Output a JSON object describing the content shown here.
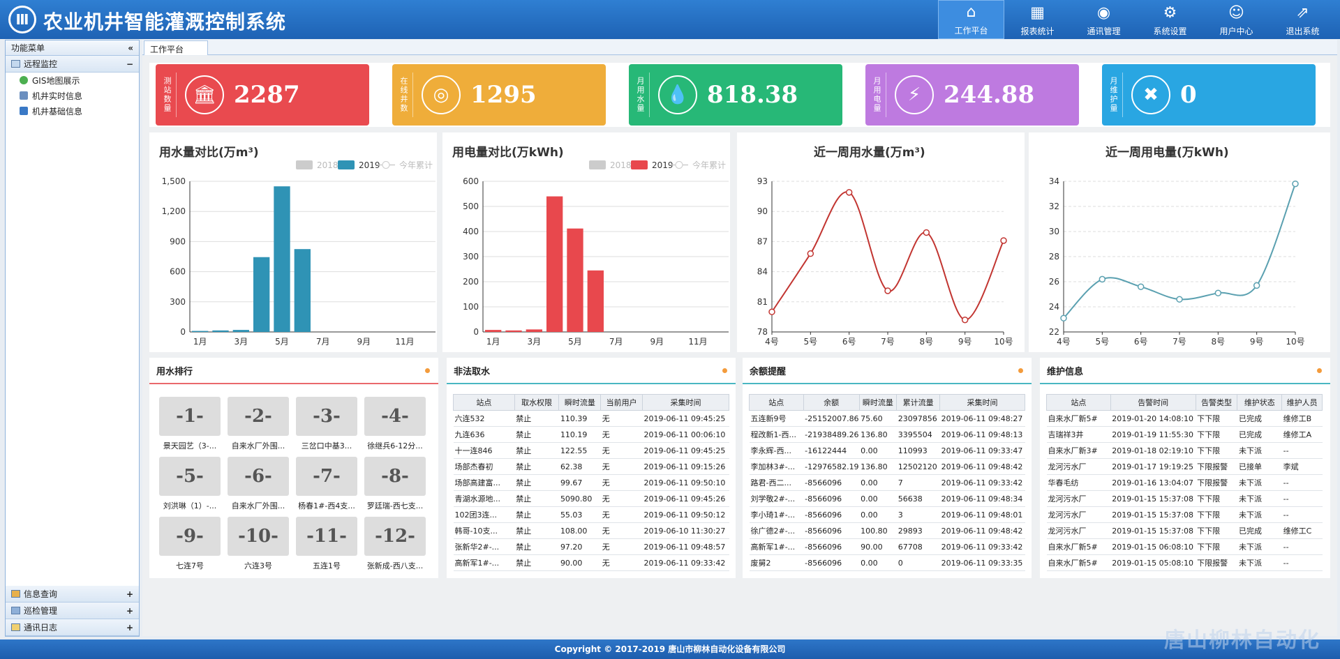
{
  "header": {
    "logo_glyph": "Ⅲ",
    "title": "农业机井智能灌溉控制系统",
    "nav": [
      {
        "label": "工作平台",
        "icon": "home-icon"
      },
      {
        "label": "报表统计",
        "icon": "report-icon"
      },
      {
        "label": "通讯管理",
        "icon": "antenna-icon"
      },
      {
        "label": "系统设置",
        "icon": "gear-icon"
      },
      {
        "label": "用户中心",
        "icon": "user-card-icon"
      },
      {
        "label": "退出系统",
        "icon": "exit-icon"
      }
    ]
  },
  "sidebar": {
    "title": "功能菜单",
    "collapse": "«",
    "groups_top": [
      {
        "label": "远程监控",
        "state": "−"
      }
    ],
    "items": [
      "GIS地图展示",
      "机井实时信息",
      "机井基础信息"
    ],
    "groups_bottom": [
      {
        "label": "信息查询",
        "state": "+"
      },
      {
        "label": "巡检管理",
        "state": "+"
      },
      {
        "label": "通讯日志",
        "state": "+"
      }
    ]
  },
  "tab": "工作平台",
  "kpis": [
    {
      "label": "测站数量",
      "value": "2287",
      "color": "#e94a4f",
      "icon": "temple-icon",
      "glyph": "🏛"
    },
    {
      "label": "在线井数",
      "value": "1295",
      "color": "#efad3a",
      "icon": "well-icon",
      "glyph": "◎"
    },
    {
      "label": "月用水量",
      "value": "818.38",
      "color": "#27b877",
      "icon": "water-drop-icon",
      "glyph": "💧"
    },
    {
      "label": "月用电量",
      "value": "244.88",
      "color": "#be7ae0",
      "icon": "lightning-icon",
      "glyph": "⚡"
    },
    {
      "label": "月维护量",
      "value": "0",
      "color": "#29a6e2",
      "icon": "tools-icon",
      "glyph": "✖"
    }
  ],
  "chart_data": [
    {
      "type": "bar",
      "title": "用水量对比(万m³)",
      "legend": [
        "2018",
        "2019",
        "今年累计"
      ],
      "categories": [
        "1月",
        "2月",
        "3月",
        "4月",
        "5月",
        "6月",
        "7月",
        "8月",
        "9月",
        "10月",
        "11月",
        "12月"
      ],
      "xticks": [
        "1月",
        "3月",
        "5月",
        "7月",
        "9月",
        "11月"
      ],
      "series": [
        {
          "name": "2019",
          "values": [
            10,
            15,
            20,
            745,
            1450,
            825,
            0,
            0,
            0,
            0,
            0,
            0
          ],
          "color": "#2f93b5"
        }
      ],
      "ylim": [
        0,
        1500
      ],
      "yticks": [
        "0",
        "300",
        "600",
        "900",
        "1,200",
        "1,500"
      ],
      "ytick_values": [
        0,
        300,
        600,
        900,
        1200,
        1500
      ],
      "grid": true,
      "legend_position": "top-right"
    },
    {
      "type": "bar",
      "title": "用电量对比(万kWh)",
      "legend": [
        "2018",
        "2019",
        "今年累计"
      ],
      "categories": [
        "1月",
        "2月",
        "3月",
        "4月",
        "5月",
        "6月",
        "7月",
        "8月",
        "9月",
        "10月",
        "11月",
        "12月"
      ],
      "xticks": [
        "1月",
        "3月",
        "5月",
        "7月",
        "9月",
        "11月"
      ],
      "series": [
        {
          "name": "2019",
          "values": [
            8,
            6,
            10,
            540,
            412,
            245,
            0,
            0,
            0,
            0,
            0,
            0
          ],
          "color": "#e8484d"
        }
      ],
      "ylim": [
        0,
        600
      ],
      "yticks": [
        "0",
        "100",
        "200",
        "300",
        "400",
        "500",
        "600"
      ],
      "ytick_values": [
        0,
        100,
        200,
        300,
        400,
        500,
        600
      ],
      "grid": true,
      "legend_position": "top-right"
    },
    {
      "type": "line",
      "title": "近一周用水量(万m³)",
      "x": [
        "4号",
        "5号",
        "6号",
        "7号",
        "8号",
        "9号",
        "10号"
      ],
      "values": [
        80,
        85.8,
        91.9,
        82.1,
        87.9,
        79.2,
        87.1
      ],
      "color": "#c23531",
      "ylim": [
        78,
        93
      ],
      "yticks": [
        "78",
        "81",
        "84",
        "87",
        "90",
        "93"
      ],
      "ytick_values": [
        78,
        81,
        84,
        87,
        90,
        93
      ],
      "grid": true
    },
    {
      "type": "line",
      "title": "近一周用电量(万kWh)",
      "x": [
        "4号",
        "5号",
        "6号",
        "7号",
        "8号",
        "9号",
        "10号"
      ],
      "values": [
        23.1,
        26.2,
        25.6,
        24.6,
        25.1,
        25.7,
        33.8
      ],
      "color": "#5aa0b0",
      "ylim": [
        22,
        34
      ],
      "yticks": [
        "22",
        "24",
        "26",
        "28",
        "30",
        "32",
        "34"
      ],
      "ytick_values": [
        22,
        24,
        26,
        28,
        30,
        32,
        34
      ],
      "grid": true
    }
  ],
  "ranking": {
    "title": "用水排行",
    "items": [
      {
        "rank": "-1-",
        "name": "景天园艺（3-..."
      },
      {
        "rank": "-2-",
        "name": "自来水厂外围..."
      },
      {
        "rank": "-3-",
        "name": "三岔口中基3..."
      },
      {
        "rank": "-4-",
        "name": "徐继兵6-12分..."
      },
      {
        "rank": "-5-",
        "name": "刘洪琳（1）-..."
      },
      {
        "rank": "-6-",
        "name": "自来水厂外围..."
      },
      {
        "rank": "-7-",
        "name": "杨春1#-西4支..."
      },
      {
        "rank": "-8-",
        "name": "罗廷瑞-西七支..."
      },
      {
        "rank": "-9-",
        "name": "七连7号"
      },
      {
        "rank": "-10-",
        "name": "六连3号"
      },
      {
        "rank": "-11-",
        "name": "五连1号"
      },
      {
        "rank": "-12-",
        "name": "张新成-西八支..."
      }
    ]
  },
  "illegal": {
    "title": "非法取水",
    "columns": [
      "站点",
      "取水权限",
      "瞬时流量",
      "当前用户",
      "采集时间"
    ],
    "rows": [
      [
        "六连532",
        "禁止",
        "110.39",
        "无",
        "2019-06-11 09:45:25"
      ],
      [
        "九连636",
        "禁止",
        "110.19",
        "无",
        "2019-06-11 00:06:10"
      ],
      [
        "十一连846",
        "禁止",
        "122.55",
        "无",
        "2019-06-11 09:45:25"
      ],
      [
        "场部杰春初",
        "禁止",
        "62.38",
        "无",
        "2019-06-11 09:15:26"
      ],
      [
        "场部高建富...",
        "禁止",
        "99.67",
        "无",
        "2019-06-11 09:50:10"
      ],
      [
        "青湖水源地...",
        "禁止",
        "5090.80",
        "无",
        "2019-06-11 09:45:26"
      ],
      [
        "102团3连...",
        "禁止",
        "55.03",
        "无",
        "2019-06-11 09:50:12"
      ],
      [
        "韩哥-10支...",
        "禁止",
        "108.00",
        "无",
        "2019-06-10 11:30:27"
      ],
      [
        "张新华2#-...",
        "禁止",
        "97.20",
        "无",
        "2019-06-11 09:48:57"
      ],
      [
        "高新军1#-...",
        "禁止",
        "90.00",
        "无",
        "2019-06-11 09:33:42"
      ]
    ]
  },
  "balance": {
    "title": "余额提醒",
    "columns": [
      "站点",
      "余额",
      "瞬时流量",
      "累计流量",
      "采集时间"
    ],
    "rows": [
      [
        "五连新9号",
        "-25152007.86",
        "75.60",
        "23097856",
        "2019-06-11 09:48:27"
      ],
      [
        "程改新1-西...",
        "-21938489.26",
        "136.80",
        "3395504",
        "2019-06-11 09:48:13"
      ],
      [
        "李永辉-西...",
        "-16122444",
        "0.00",
        "110993",
        "2019-06-11 09:33:47"
      ],
      [
        "李加林3#-...",
        "-12976582.19",
        "136.80",
        "12502120",
        "2019-06-11 09:48:42"
      ],
      [
        "路君-西二...",
        "-8566096",
        "0.00",
        "7",
        "2019-06-11 09:33:42"
      ],
      [
        "刘学敬2#-...",
        "-8566096",
        "0.00",
        "56638",
        "2019-06-11 09:48:34"
      ],
      [
        "李小琦1#-...",
        "-8566096",
        "0.00",
        "3",
        "2019-06-11 09:48:01"
      ],
      [
        "徐广德2#-...",
        "-8566096",
        "100.80",
        "29893",
        "2019-06-11 09:48:42"
      ],
      [
        "高新军1#-...",
        "-8566096",
        "90.00",
        "67708",
        "2019-06-11 09:33:42"
      ],
      [
        "废舅2",
        "-8566096",
        "0.00",
        "0",
        "2019-06-11 09:33:35"
      ]
    ]
  },
  "maintenance": {
    "title": "维护信息",
    "columns": [
      "站点",
      "告警时间",
      "告警类型",
      "维护状态",
      "维护人员"
    ],
    "rows": [
      [
        "自来水厂新5#",
        "2019-01-20 14:08:10",
        "下下限",
        "已完成",
        "维修工B"
      ],
      [
        "吉瑞祥3井",
        "2019-01-19 11:55:30",
        "下下限",
        "已完成",
        "维修工A"
      ],
      [
        "自来水厂新3#",
        "2019-01-18 02:19:10",
        "下下限",
        "未下派",
        "--"
      ],
      [
        "龙河污水厂",
        "2019-01-17 19:19:25",
        "下限报警",
        "已接单",
        "李斌"
      ],
      [
        "华春毛纺",
        "2019-01-16 13:04:07",
        "下限报警",
        "未下派",
        "--"
      ],
      [
        "龙河污水厂",
        "2019-01-15 15:37:08",
        "下下限",
        "未下派",
        "--"
      ],
      [
        "龙河污水厂",
        "2019-01-15 15:37:08",
        "下下限",
        "未下派",
        "--"
      ],
      [
        "龙河污水厂",
        "2019-01-15 15:37:08",
        "下下限",
        "已完成",
        "维修工C"
      ],
      [
        "自来水厂新5#",
        "2019-01-15 06:08:10",
        "下下限",
        "未下派",
        "--"
      ],
      [
        "自来水厂新5#",
        "2019-01-15 05:08:10",
        "下限报警",
        "未下派",
        "--"
      ]
    ]
  },
  "footer": "Copyright © 2017-2019  唐山市柳林自动化设备有限公司",
  "watermark": "唐山柳林自动化"
}
